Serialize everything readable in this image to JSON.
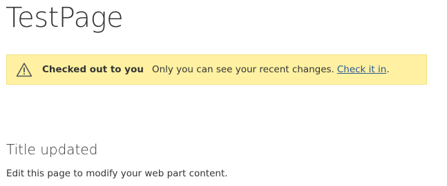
{
  "page": {
    "title": "TestPage"
  },
  "banner": {
    "icon": "warning-triangle-icon",
    "status": "Checked out to you",
    "message": "Only you can see your recent changes.",
    "link_text": "Check it in",
    "link_suffix": ".",
    "colors": {
      "background": "#fff1a1",
      "link": "#2b5797"
    }
  },
  "webpart": {
    "title": "Title updated",
    "content": "Edit this page to modify your web part content."
  }
}
